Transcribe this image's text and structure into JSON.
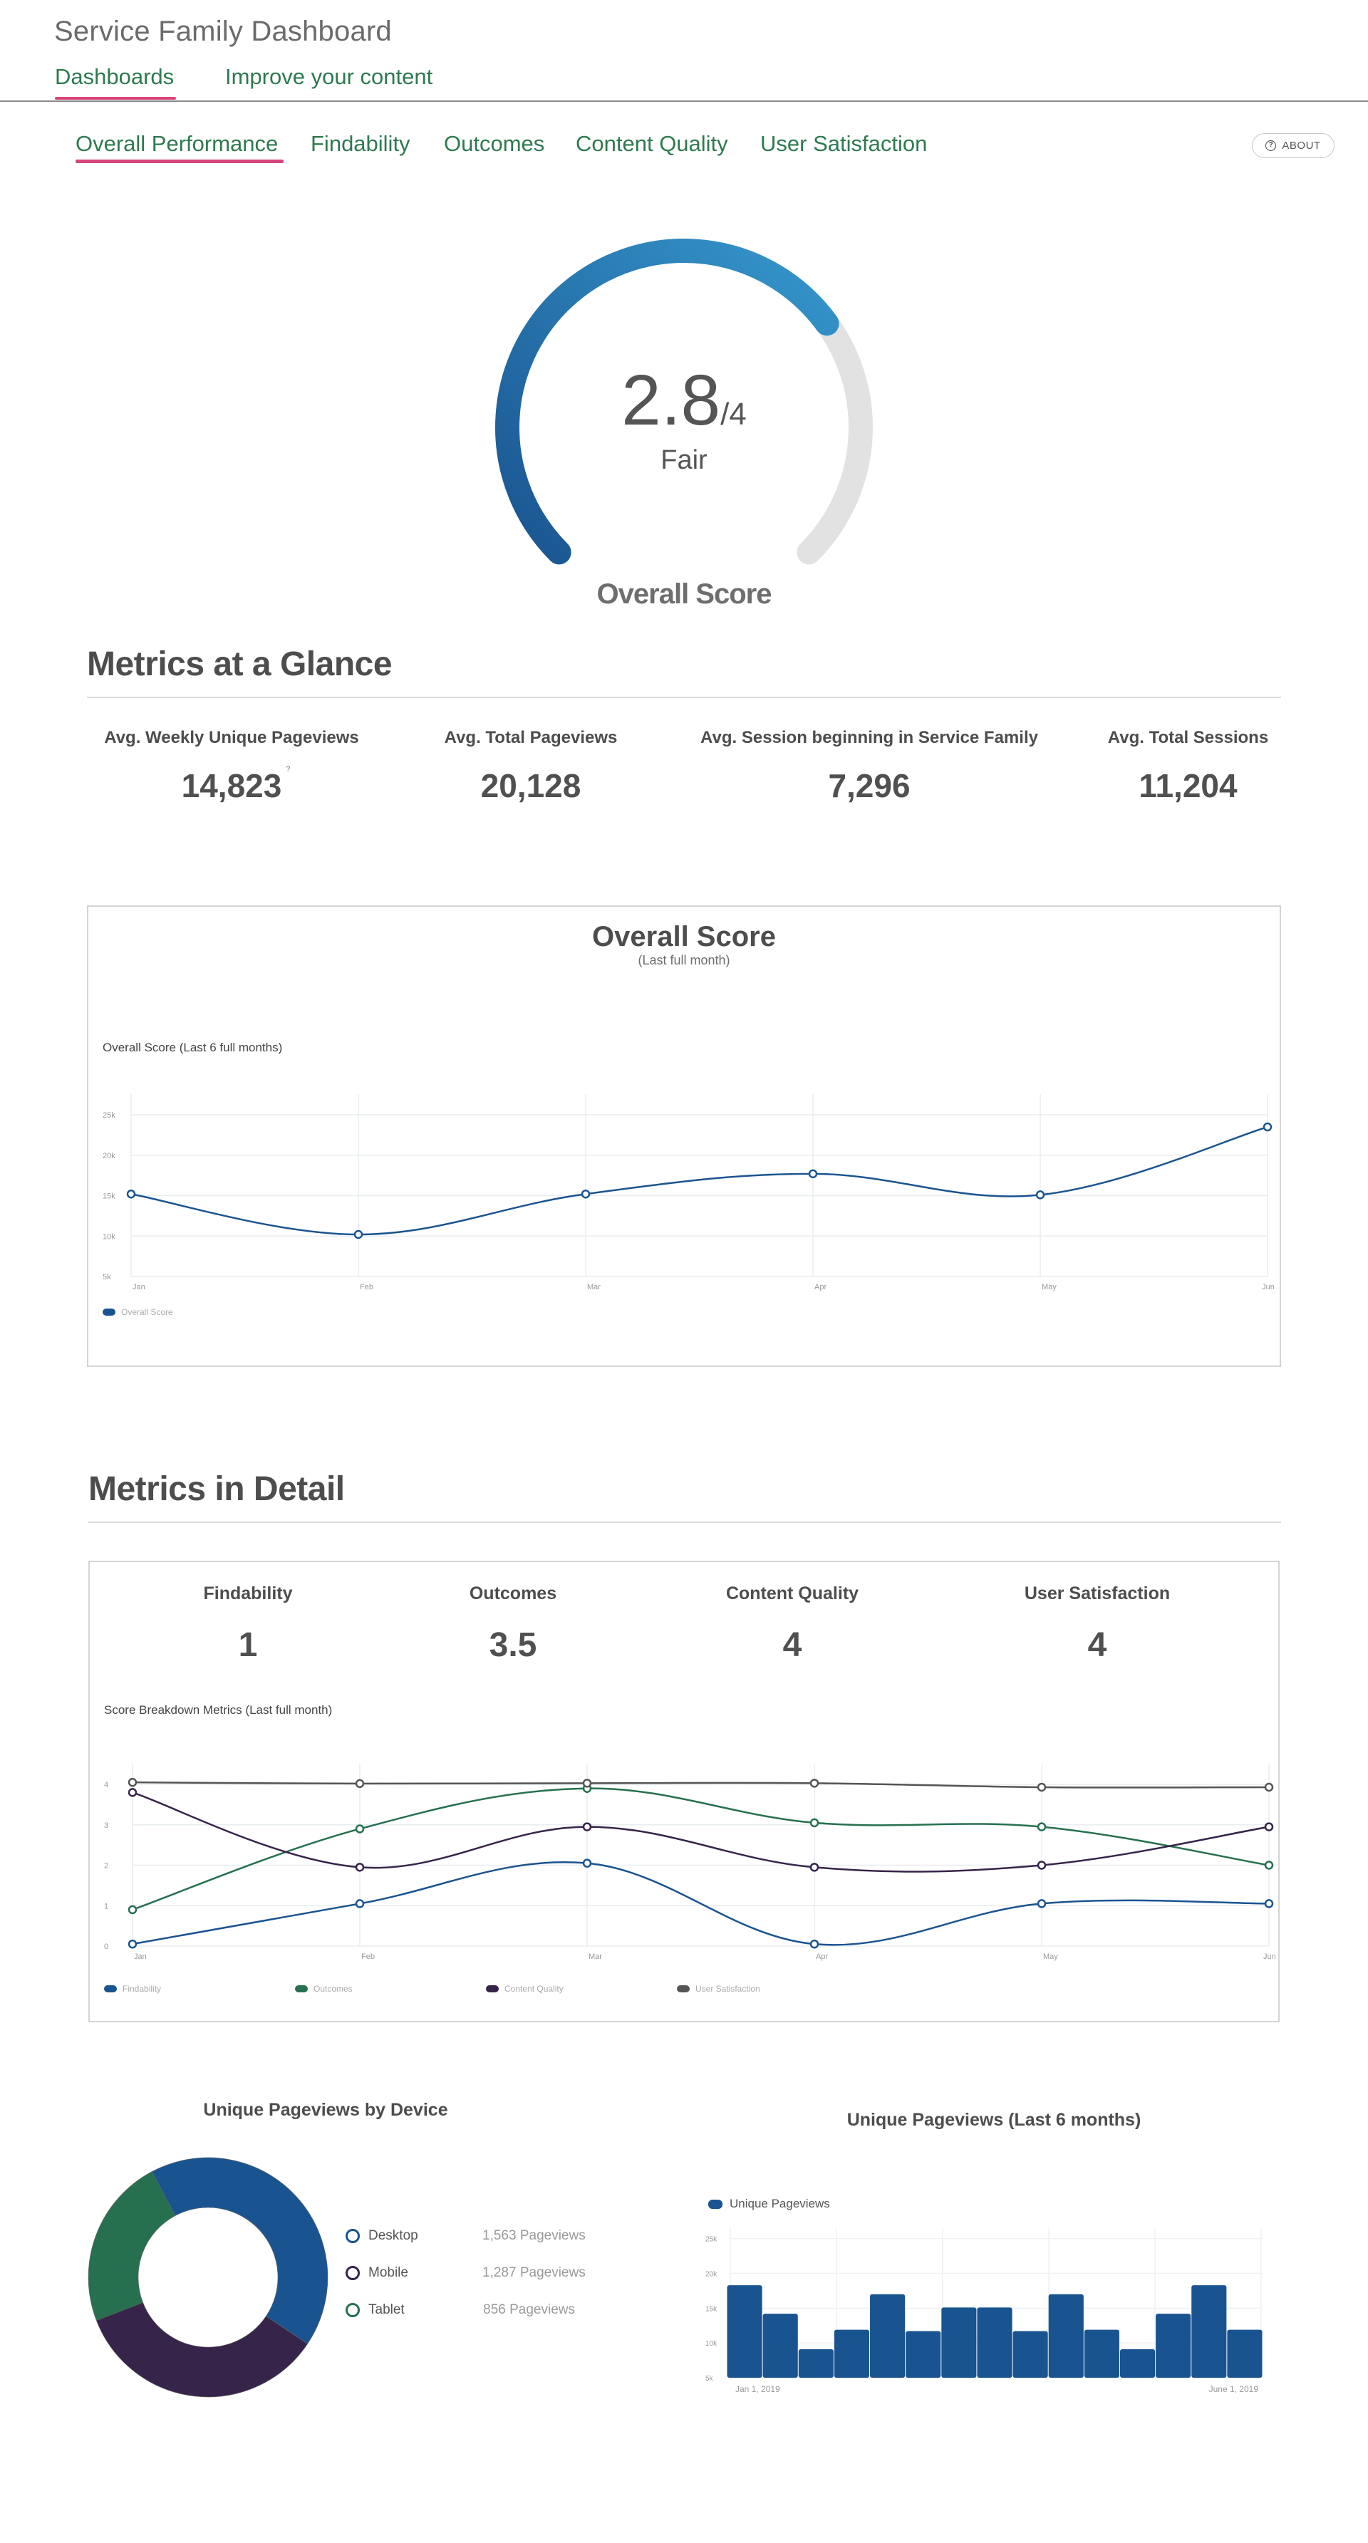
{
  "app": {
    "title": "Service Family Dashboard",
    "top_nav": [
      {
        "label": "Dashboards",
        "active": true
      },
      {
        "label": "Improve your content",
        "active": false
      }
    ]
  },
  "sub_tabs": [
    {
      "label": "Overall Performance",
      "active": true
    },
    {
      "label": "Findability",
      "active": false
    },
    {
      "label": "Outcomes",
      "active": false
    },
    {
      "label": "Content Quality",
      "active": false
    },
    {
      "label": "User Satisfaction",
      "active": false
    }
  ],
  "about_button": {
    "label": "ABOUT",
    "icon": "help-circle-icon"
  },
  "gauge": {
    "score": "2.8",
    "max": "/4",
    "score_value": 2.8,
    "max_value": 4,
    "rating": "Fair",
    "title": "Overall Score",
    "colors": {
      "start": "#1a5490",
      "end": "#3597cc",
      "track": "#e2e2e2"
    }
  },
  "metrics_at_a_glance": {
    "title": "Metrics at a Glance",
    "items": [
      {
        "label": "Avg. Weekly Unique Pageviews",
        "value": "14,823",
        "has_info": true,
        "info_icon": "?"
      },
      {
        "label": "Avg. Total Pageviews",
        "value": "20,128"
      },
      {
        "label": "Avg. Session beginning in Service Family",
        "value": "7,296"
      },
      {
        "label": "Avg. Total Sessions",
        "value": "11,204"
      }
    ]
  },
  "overall_score_card": {
    "title": "Overall Score",
    "subtitle": "(Last full month)",
    "chart_caption": "Overall Score (Last 6 full months)"
  },
  "metrics_in_detail": {
    "title": "Metrics in Detail",
    "items": [
      {
        "label": "Findability",
        "value": "1"
      },
      {
        "label": "Outcomes",
        "value": "3.5"
      },
      {
        "label": "Content Quality",
        "value": "4"
      },
      {
        "label": "User Satisfaction",
        "value": "4"
      }
    ],
    "chart_caption": "Score Breakdown Metrics (Last full month)"
  },
  "device_card": {
    "title": "Unique Pageviews by Device",
    "suffix": "Pageviews"
  },
  "pageviews_card": {
    "title": "Unique Pageviews (Last 6 months)"
  },
  "chart_data": [
    {
      "id": "overall-score-line",
      "type": "line",
      "title": "Overall Score (Last 6 full months)",
      "categories": [
        "Jan",
        "Feb",
        "Mar",
        "Apr",
        "May",
        "Jun"
      ],
      "yticks": [
        "5k",
        "10k",
        "15k",
        "20k",
        "25k"
      ],
      "ylim": [
        5000,
        26500
      ],
      "grid": true,
      "legend": "bottom-left",
      "series": [
        {
          "name": "Overall Score",
          "color": "#1a5490",
          "values": [
            15200,
            10200,
            15200,
            17700,
            15100,
            23500
          ]
        }
      ]
    },
    {
      "id": "score-breakdown-line",
      "type": "line",
      "title": "Score Breakdown Metrics (Last full month)",
      "categories": [
        "Jan",
        "Feb",
        "Mar",
        "Apr",
        "May",
        "Jun"
      ],
      "yticks": [
        "0",
        "1",
        "2",
        "3",
        "4"
      ],
      "ylim": [
        0,
        4.3
      ],
      "grid": true,
      "legend": "bottom-left",
      "series": [
        {
          "name": "Findability",
          "color": "#1a5490",
          "values": [
            0.05,
            1.05,
            2.05,
            0.05,
            1.05,
            1.05
          ]
        },
        {
          "name": "Outcomes",
          "color": "#26704f",
          "values": [
            0.9,
            2.9,
            3.9,
            3.05,
            2.95,
            2.0
          ]
        },
        {
          "name": "Content Quality",
          "color": "#36244a",
          "values": [
            3.8,
            1.95,
            2.95,
            1.95,
            2.0,
            2.95
          ]
        },
        {
          "name": "User Satisfaction",
          "color": "#555555",
          "values": [
            4.05,
            4.02,
            4.03,
            4.03,
            3.93,
            3.93
          ]
        }
      ]
    },
    {
      "id": "device-donut",
      "type": "pie",
      "title": "Unique Pageviews by Device",
      "series": [
        {
          "name": "Desktop",
          "value": 1563,
          "label": "1,563 Pageviews",
          "color": "#1a5490"
        },
        {
          "name": "Mobile",
          "value": 1287,
          "label": "1,287 Pageviews",
          "color": "#36244a"
        },
        {
          "name": "Tablet",
          "value": 856,
          "label": "856 Pageviews",
          "color": "#26704f"
        }
      ]
    },
    {
      "id": "pageviews-bar",
      "type": "bar",
      "title": "Unique Pageviews (Last 6 months)",
      "legend": "top-left",
      "series_name": "Unique Pageviews",
      "color": "#1a5490",
      "x_start_label": "Jan 1, 2019",
      "x_end_label": "June 1, 2019",
      "yticks": [
        "5k",
        "10k",
        "15k",
        "20k",
        "25k"
      ],
      "ylim": [
        5000,
        26500
      ],
      "values": [
        18300,
        14200,
        9100,
        11900,
        17000,
        11700,
        15100,
        15100,
        11700,
        17000,
        11900,
        9100,
        14200,
        18300,
        11900
      ]
    }
  ]
}
